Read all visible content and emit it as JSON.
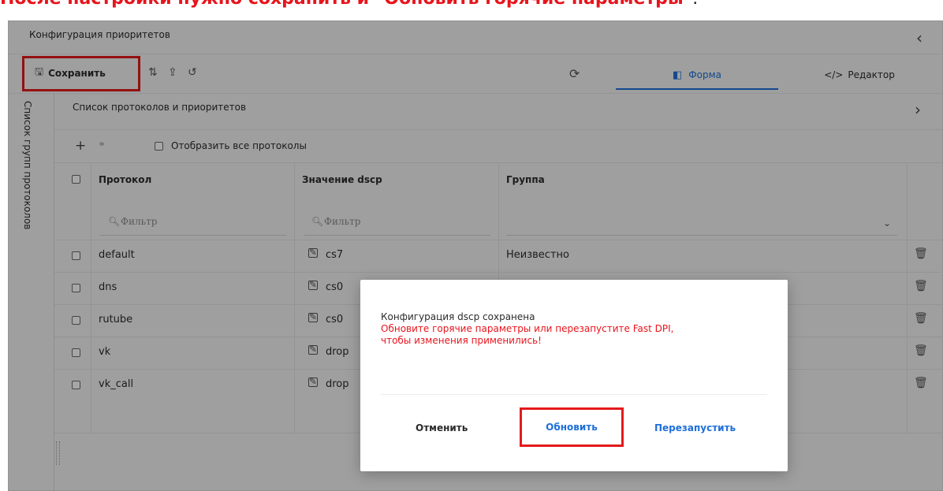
{
  "headline": {
    "text": "После настройки нужно сохранить и \"Обновить горячие параметры\"",
    "tail": "."
  },
  "panel": {
    "title": "Конфигурация приоритетов",
    "collapse_glyph": "‹"
  },
  "toolbar": {
    "save_label": "Сохранить",
    "save_glyph": "🖫",
    "swap_glyph": "⇅",
    "upload_glyph": "⇪",
    "history_glyph": "↺",
    "refresh_glyph": "⟳",
    "tab_form": "Форма",
    "tab_form_glyph": "◧",
    "tab_editor": "Редактор",
    "tab_editor_glyph": "</>"
  },
  "sidebar": {
    "label": "Список групп протоколов"
  },
  "list": {
    "title": "Список протоколов и приоритетов",
    "expand_glyph": "›",
    "add_glyph": "+",
    "link_glyph": "⚭",
    "show_all_label": "Отобразить все протоколы"
  },
  "table": {
    "columns": [
      "Протокол",
      "Значение dscp",
      "Группа"
    ],
    "filter_placeholder": "Фильтр",
    "rows": [
      {
        "protocol": "default",
        "dscp": "cs7",
        "group": "Неизвестно"
      },
      {
        "protocol": "dns",
        "dscp": "cs0",
        "group": ""
      },
      {
        "protocol": "rutube",
        "dscp": "cs0",
        "group": ""
      },
      {
        "protocol": "vk",
        "dscp": "drop",
        "group": ""
      },
      {
        "protocol": "vk_call",
        "dscp": "drop",
        "group": ""
      }
    ],
    "delete_glyph": "🗑",
    "edit_glyph": "✎"
  },
  "dialog": {
    "message": "Конфигурация dscp сохранена",
    "warning_line1": "Обновите горячие параметры или перезапустите Fast DPI,",
    "warning_line2": "чтобы изменения применились!",
    "cancel_label": "Отменить",
    "update_label": "Обновить",
    "restart_label": "Перезапустить"
  },
  "colors": {
    "accent": "#1e6fd9",
    "warning": "#e8141c",
    "highlight_border": "#e31b1b"
  }
}
